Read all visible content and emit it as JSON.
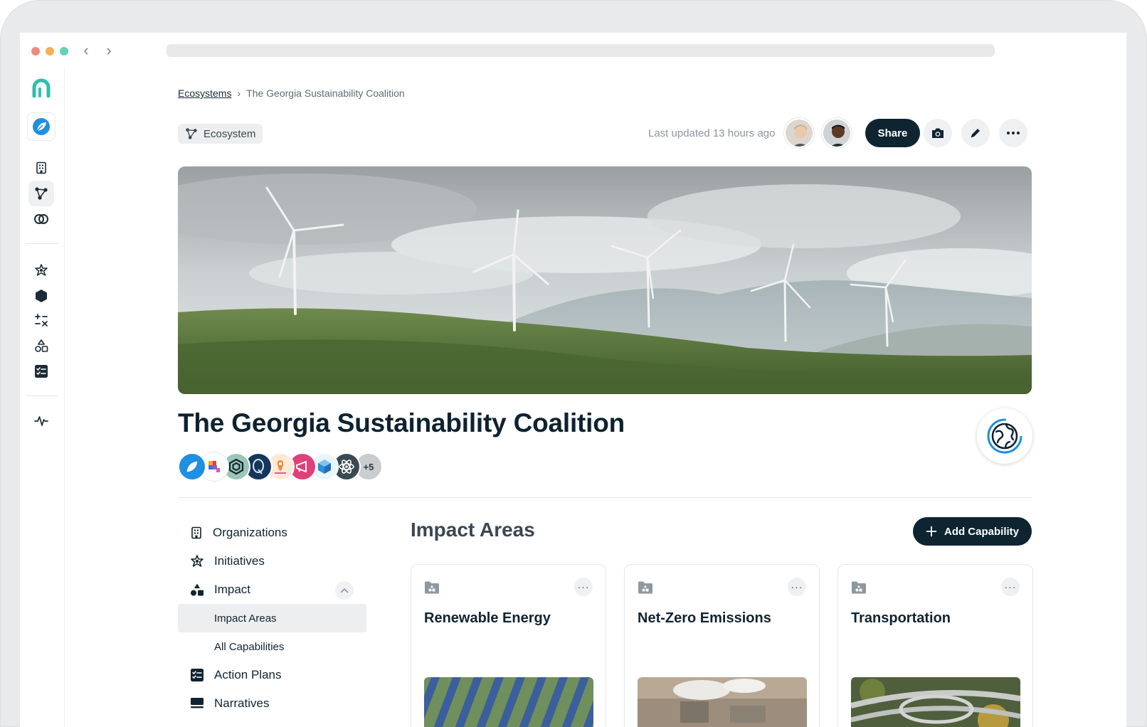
{
  "breadcrumb": {
    "root": "Ecosystems",
    "separator": "›",
    "current": "The Georgia Sustainability Coalition"
  },
  "header": {
    "tag_label": "Ecosystem",
    "last_updated": "Last updated 13 hours ago",
    "share_label": "Share"
  },
  "page": {
    "title": "The Georgia Sustainability Coalition"
  },
  "members": {
    "more_count": "+5"
  },
  "side_nav": {
    "organizations": "Organizations",
    "initiatives": "Initiatives",
    "impact": "Impact",
    "impact_areas": "Impact Areas",
    "all_capabilities": "All Capabilities",
    "action_plans": "Action Plans",
    "narratives": "Narratives"
  },
  "section": {
    "title": "Impact Areas",
    "add_label": "Add Capability"
  },
  "cards": [
    {
      "title": "Renewable Energy"
    },
    {
      "title": "Net-Zero Emissions"
    },
    {
      "title": "Transportation"
    }
  ],
  "colors": {
    "primary": "#0e2430",
    "brand_teal": "#2fbfad",
    "accent_blue": "#1f8fe0"
  },
  "icons": {
    "rail": [
      "brand-logo-icon",
      "leaf-badge-icon",
      "building-icon",
      "ecosystem-icon",
      "rings-icon",
      "initiatives-icon",
      "hexagon-icon",
      "calculator-icon",
      "shapes-icon",
      "checklist-icon",
      "activity-icon"
    ]
  }
}
